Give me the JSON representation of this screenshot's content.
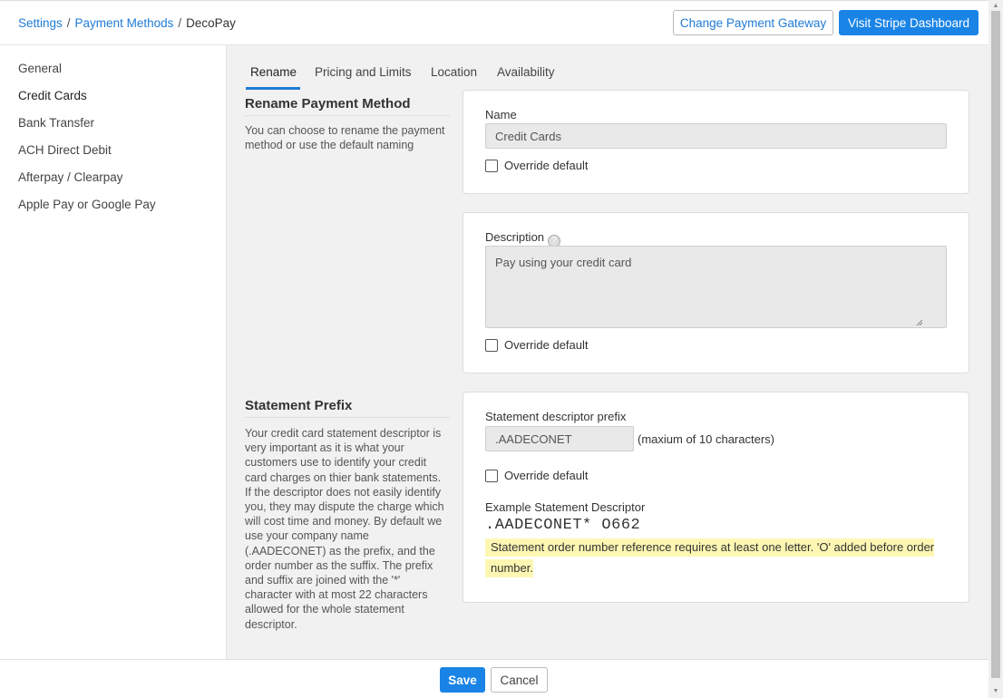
{
  "breadcrumb": {
    "settings": "Settings",
    "separator": "/",
    "payment_methods": "Payment Methods",
    "current": "DecoPay"
  },
  "header": {
    "change_gateway": "Change Payment Gateway",
    "visit_stripe": "Visit Stripe Dashboard"
  },
  "sidebar": {
    "items": [
      {
        "label": "General",
        "active": false
      },
      {
        "label": "Credit Cards",
        "active": true
      },
      {
        "label": "Bank Transfer",
        "active": false
      },
      {
        "label": "ACH Direct Debit",
        "active": false
      },
      {
        "label": "Afterpay / Clearpay",
        "active": false
      },
      {
        "label": "Apple Pay or Google Pay",
        "active": false
      }
    ]
  },
  "tabs": [
    {
      "label": "Rename",
      "active": true
    },
    {
      "label": "Pricing and Limits",
      "active": false
    },
    {
      "label": "Location",
      "active": false
    },
    {
      "label": "Availability",
      "active": false
    }
  ],
  "rename": {
    "title": "Rename Payment Method",
    "description": "You can choose to rename the payment method or use the default naming",
    "name_label": "Name",
    "name_value": "Credit Cards",
    "override_label": "Override default",
    "description_label": "Description",
    "description_value": "Pay using your credit card",
    "description_override_label": "Override default"
  },
  "statement": {
    "title": "Statement Prefix",
    "description": "Your credit card statement descriptor is very important as it is what your customers use to identify your credit card charges on thier bank statements. If the descriptor does not easily identify you, they may dispute the charge which will cost time and money. By default we use your company name (.AADECONET) as the prefix, and the order number as the suffix. The prefix and suffix are joined with the '*' character with at most 22 characters allowed for the whole statement descriptor.",
    "prefix_label": "Statement descriptor prefix",
    "prefix_value": ".AADECONET",
    "prefix_hint": "(maxium of 10 characters)",
    "override_label": "Override default",
    "example_label": "Example Statement Descriptor",
    "example_value": ".AADECONET* O662",
    "warning": "Statement order number reference requires at least one letter. 'O' added before order number."
  },
  "footer": {
    "save": "Save",
    "cancel": "Cancel"
  },
  "colors": {
    "accent": "#1a84e6",
    "link": "#1f7bd6",
    "warning_bg": "#fdf7b3"
  },
  "icons": {
    "help": "help-circle-icon",
    "resize": "resize-grip-icon",
    "scroll_up": "triangle-up-icon",
    "scroll_down": "triangle-down-icon"
  }
}
